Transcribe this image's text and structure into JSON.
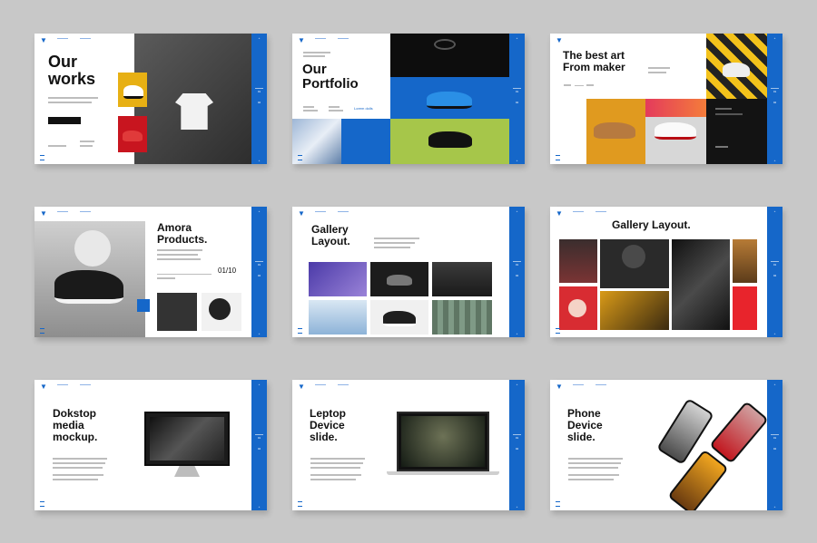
{
  "slides": [
    {
      "title": "Our\nworks",
      "button": "",
      "nav": [
        "",
        ""
      ]
    },
    {
      "title": "Our\nPortfolio",
      "badge": "Lorem dolls"
    },
    {
      "title": "The best art\nFrom maker"
    },
    {
      "title": "Amora\nProducts.",
      "counter": "01/10"
    },
    {
      "title": "Gallery\nLayout."
    },
    {
      "title": "Gallery  Layout."
    },
    {
      "title": "Dokstop\nmedia\nmockup."
    },
    {
      "title": "Leptop\nDevice\nslide."
    },
    {
      "title": "Phone\nDevice\nslide."
    }
  ],
  "colors": {
    "accent": "#1567c9",
    "background": "#c8c8c8"
  }
}
